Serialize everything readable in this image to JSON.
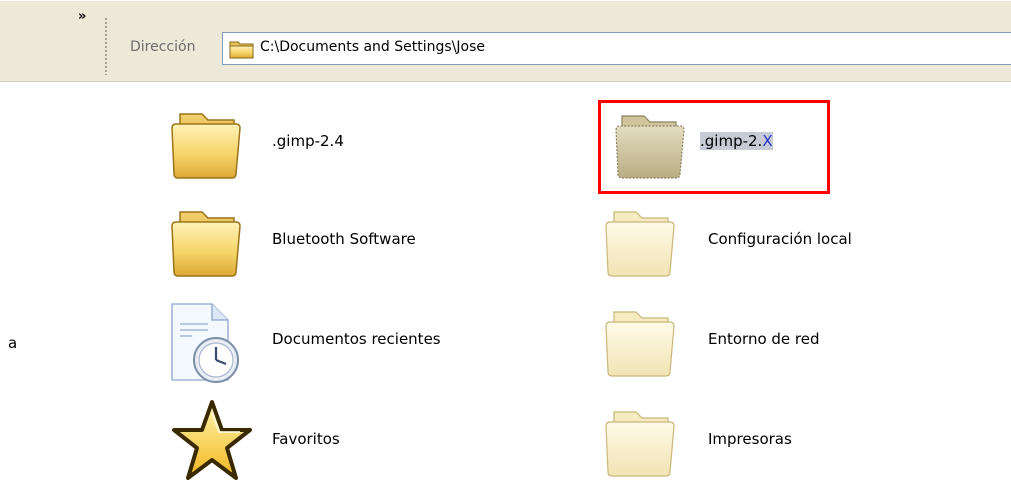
{
  "toolbar": {
    "chevron": "»",
    "address_label": "Dirección",
    "address_path": "C:\\Documents and Settings\\Jose"
  },
  "left_pane": {
    "text": "a"
  },
  "items": [
    {
      "label": ".gimp-2.4",
      "icon": "folder-icon"
    },
    {
      "label_plain": ".gimp-2.",
      "label_last": "X",
      "icon": "folder-open-dim-icon",
      "selected": true
    },
    {
      "label": "Bluetooth Software",
      "icon": "folder-icon"
    },
    {
      "label": "Configuración local",
      "icon": "folder-faded-icon"
    },
    {
      "label": "Documentos recientes",
      "icon": "recent-documents-icon"
    },
    {
      "label": "Entorno de red",
      "icon": "folder-faded-icon"
    },
    {
      "label": "Favoritos",
      "icon": "star-icon"
    },
    {
      "label": "Impresoras",
      "icon": "folder-faded-icon"
    }
  ],
  "colors": {
    "toolbar_bg": "#ece9d8",
    "selection_border": "#ff0000",
    "highlight_bg": "#c8cbd6"
  }
}
